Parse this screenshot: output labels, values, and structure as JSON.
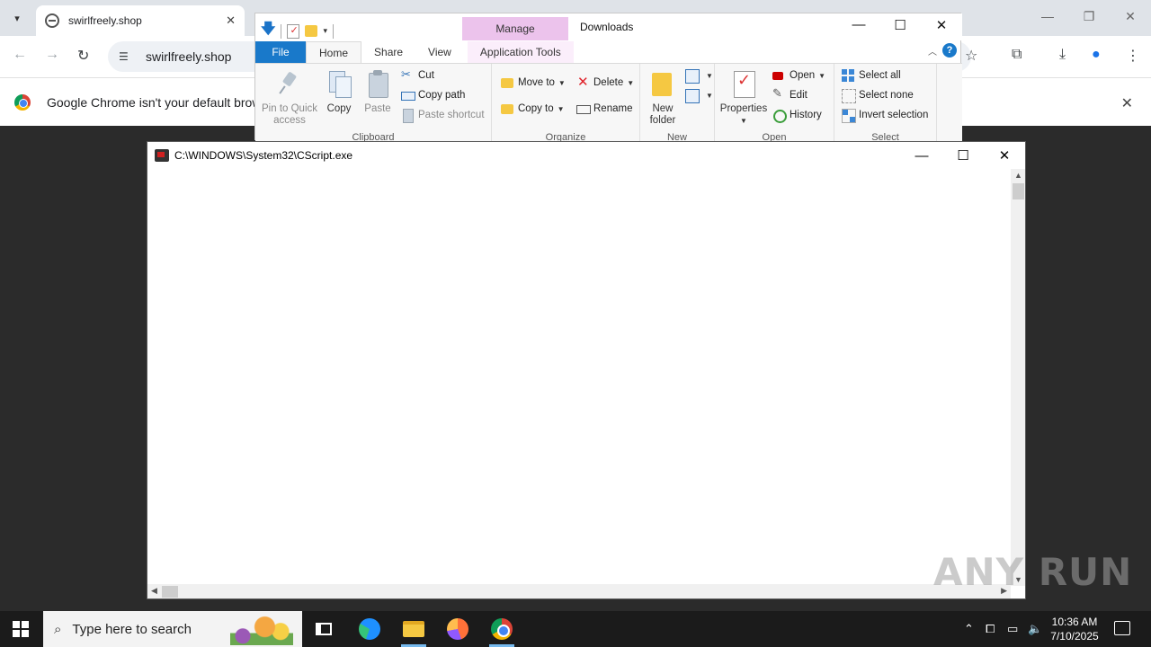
{
  "chrome": {
    "tab_title": "swirlfreely.shop",
    "url": "swirlfreely.shop",
    "infobar_message": "Google Chrome isn't your default browse",
    "icons": {
      "tab_search": "chevron-down-icon",
      "back": "arrow-left-icon",
      "forward": "arrow-right-icon",
      "reload": "reload-icon",
      "site_info": "tune-icon",
      "bookmark": "star-icon",
      "extensions": "puzzle-icon",
      "downloads": "download-icon",
      "profile": "person-icon",
      "menu": "kebab-menu-icon"
    }
  },
  "explorer": {
    "window_title": "Downloads",
    "context_tab_group": "Manage",
    "tabs": [
      "File",
      "Home",
      "Share",
      "View",
      "Application Tools"
    ],
    "clipboard": {
      "pin_label": "Pin to Quick access",
      "copy_label": "Copy",
      "paste_label": "Paste",
      "cut_label": "Cut",
      "copy_path_label": "Copy path",
      "paste_shortcut_label": "Paste shortcut",
      "group_label": "Clipboard"
    },
    "organize": {
      "move_to_label": "Move to",
      "copy_to_label": "Copy to",
      "delete_label": "Delete",
      "rename_label": "Rename",
      "group_label": "Organize"
    },
    "new": {
      "new_folder_label": "New folder",
      "group_label": "New"
    },
    "open": {
      "properties_label": "Properties",
      "open_label": "Open",
      "edit_label": "Edit",
      "history_label": "History",
      "group_label": "Open"
    },
    "select": {
      "select_all_label": "Select all",
      "select_none_label": "Select none",
      "invert_selection_label": "Invert selection",
      "group_label": "Select"
    }
  },
  "cscript": {
    "title": "C:\\WINDOWS\\System32\\CScript.exe"
  },
  "watermark": "ANY RUN",
  "taskbar": {
    "search_placeholder": "Type here to search",
    "time": "10:36 AM",
    "date": "7/10/2025",
    "apps": [
      "task-view",
      "edge",
      "file-explorer",
      "firefox",
      "chrome"
    ]
  }
}
